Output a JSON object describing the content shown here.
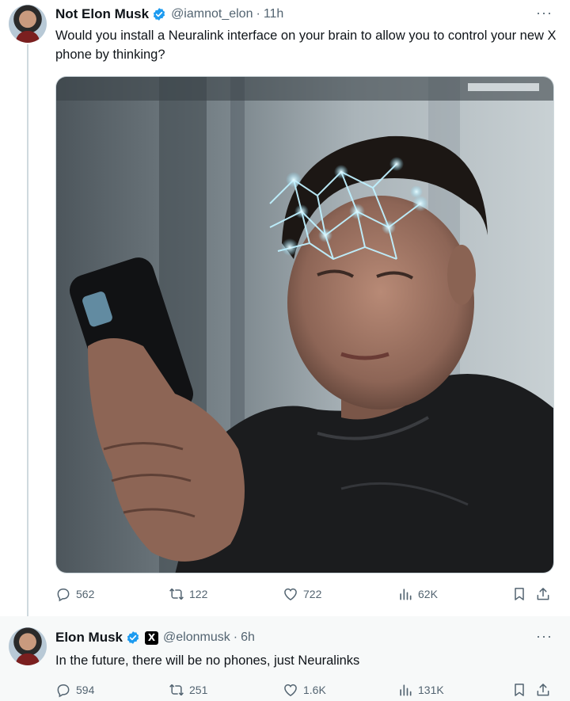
{
  "tweets": [
    {
      "name": "Not Elon Musk",
      "handle": "@iamnot_elon",
      "time": "11h",
      "text": "Would you install a Neuralink interface on your brain to allow you to control your new X phone by thinking?",
      "stats": {
        "replies": "562",
        "retweets": "122",
        "likes": "722",
        "views": "62K"
      }
    },
    {
      "name": "Elon Musk",
      "handle": "@elonmusk",
      "time": "6h",
      "text": "In the future, there will be no phones, just Neuralinks",
      "stats": {
        "replies": "594",
        "retweets": "251",
        "likes": "1.6K",
        "views": "131K"
      }
    }
  ],
  "separator": "·",
  "more_label": "···",
  "x_badge_glyph": "X",
  "colors": {
    "verified": "#1d9bf0",
    "secondary_text": "#536471",
    "thread_line": "#cfd9de"
  },
  "icons": [
    "verified-badge-icon",
    "reply-icon",
    "retweet-icon",
    "like-icon",
    "views-icon",
    "bookmark-icon",
    "share-icon",
    "more-icon",
    "x-affiliate-icon"
  ]
}
